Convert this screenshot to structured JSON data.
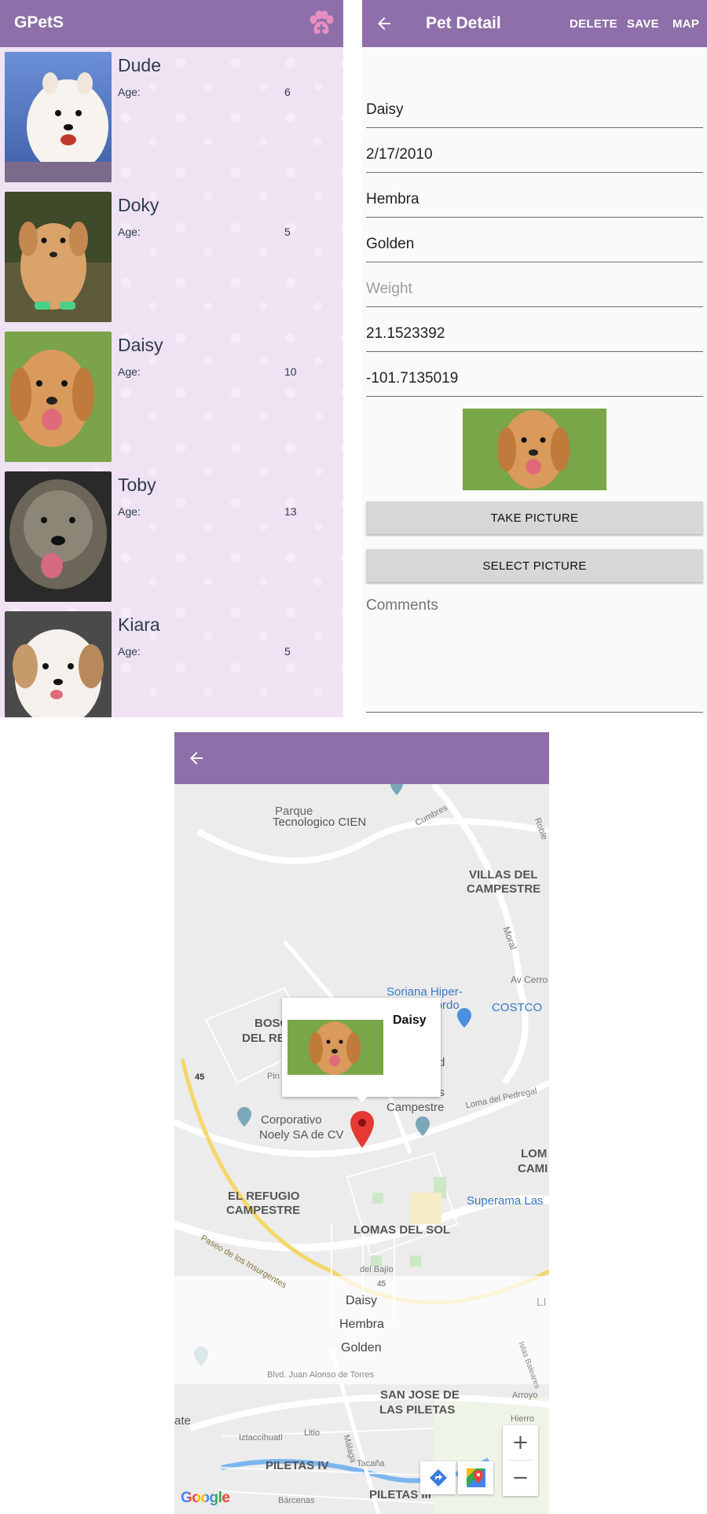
{
  "list_screen": {
    "app_title": "GPetS",
    "age_label": "Age:",
    "pets": [
      {
        "name": "Dude",
        "age": "6"
      },
      {
        "name": "Doky",
        "age": "5"
      },
      {
        "name": "Daisy",
        "age": "10"
      },
      {
        "name": "Toby",
        "age": "13"
      },
      {
        "name": "Kiara",
        "age": "5"
      }
    ]
  },
  "detail_screen": {
    "title": "Pet Detail",
    "actions": {
      "delete": "DELETE",
      "save": "SAVE",
      "map": "MAP"
    },
    "fields": {
      "name": "Daisy",
      "birth_date": "2/17/2010",
      "sex": "Hembra",
      "breed": "Golden",
      "weight_placeholder": "Weight",
      "latitude": "21.1523392",
      "longitude": "-101.7135019",
      "comments_placeholder": "Comments"
    },
    "take_picture_label": "TAKE PICTURE",
    "select_picture_label": "SELECT PICTURE"
  },
  "map_screen": {
    "info_window_title": "Daisy",
    "labels": {
      "parque": "Parque",
      "tecnologico": "Tecnologico CIEN",
      "cumbres": "Cumbres",
      "roble": "Roble",
      "villas1": "VILLAS DEL",
      "villas2": "CAMPESTRE",
      "moral": "Moral",
      "av_cerro": "Av Cerro",
      "soriana1": "Soriana Hiper-",
      "soriana2": "Gordo",
      "costco": "COSTCO",
      "bosq1": "BOSQ",
      "bosq2": "DEL RE",
      "d_frag": "d",
      "us_frag": "us",
      "campestre_frag": "Campestre",
      "pine": "Pin",
      "loma_pedregal": "Loma del Pedregal",
      "corp1": "Corporativo",
      "corp2": "Noely SA de CV",
      "lom1": "LOM",
      "lom2": "CAMI",
      "refugio1": "EL REFUGIO",
      "refugio2": "CAMPESTRE",
      "superama": "Superama Las",
      "lomas_sol": "LOMAS DEL SOL",
      "paseo": "Paseo de los Insurgentes",
      "del_bajio": "del Bajío",
      "hw45a": "45",
      "hw45b": "45",
      "li": "LI",
      "bulevard": "Blvd. Juan Alonso de Torres",
      "islas": "Islas Baleares",
      "sanjose1": "SAN JOSE DE",
      "sanjose2": "LAS PILETAS",
      "arroyo": "Arroyo",
      "hierro": "Hierro",
      "ate": "ate",
      "iztac": "Iztaccíhuatl",
      "litio": "Litio",
      "malaga": "Málaga",
      "piletas4": "PILETAS IV",
      "tacuba": "Tacaña",
      "piletas3": "PILETAS III",
      "barcenas": "Bárcenas",
      "google": "Google"
    },
    "bottom_info": {
      "name": "Daisy",
      "sex": "Hembra",
      "breed": "Golden"
    },
    "zoom_in": "+",
    "zoom_out": "−"
  },
  "colors": {
    "primary": "#8e6fa9",
    "list_bg": "#efe2f2",
    "accent_pink": "#e88fbf"
  },
  "icons": [
    "paw-add-icon",
    "back-arrow-icon",
    "map-marker-icon",
    "directions-icon",
    "maps-app-icon"
  ]
}
